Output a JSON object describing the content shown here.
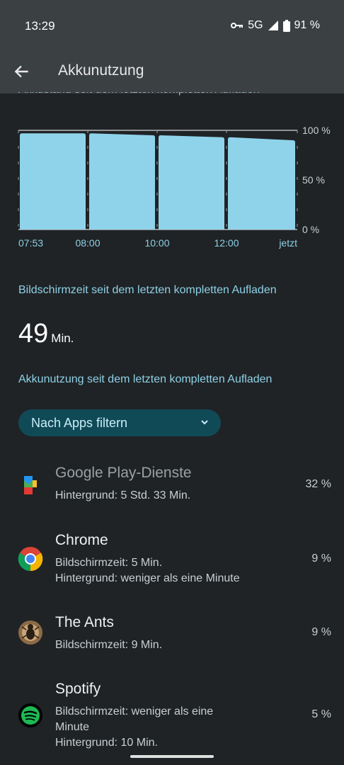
{
  "status": {
    "time": "13:29",
    "network": "5G",
    "battery": "91 %"
  },
  "appbar": {
    "title": "Akkunutzung"
  },
  "cut_text": "Akkustand seit dem letzten kompletten Aufladen",
  "chart_data": {
    "type": "bar",
    "categories": [
      "07:53–08:00",
      "08:00–10:00",
      "10:00–12:00",
      "12:00–jetzt"
    ],
    "values_start": [
      97,
      97,
      95,
      93
    ],
    "values_end": [
      97,
      95,
      93,
      90
    ],
    "ylim": [
      0,
      100
    ],
    "y_ticks": [
      "100 %",
      "50 %",
      "0 %"
    ],
    "x_ticks": [
      "07:53",
      "08:00",
      "10:00",
      "12:00",
      "jetzt"
    ],
    "bar_color": "#8fd3ea"
  },
  "screen_time": {
    "heading": "Bildschirmzeit seit dem letzten kompletten Aufladen",
    "value": "49",
    "unit": "Min."
  },
  "usage": {
    "heading": "Akkunutzung seit dem letzten kompletten Aufladen",
    "filter_label": "Nach Apps filtern"
  },
  "apps": [
    {
      "name": "Google Play-Dienste",
      "lines": [
        "Hintergrund: 5 Std. 33 Min."
      ],
      "percent": "32 %",
      "icon": "google-play-services-icon"
    },
    {
      "name": "Chrome",
      "lines": [
        "Bildschirmzeit: 5 Min.",
        "Hintergrund: weniger als eine Minute"
      ],
      "percent": "9 %",
      "icon": "chrome-icon"
    },
    {
      "name": "The Ants",
      "lines": [
        "Bildschirmzeit: 9 Min."
      ],
      "percent": "9 %",
      "icon": "the-ants-icon"
    },
    {
      "name": "Spotify",
      "lines": [
        "Bildschirmzeit: weniger als eine",
        "Minute",
        "Hintergrund: 10 Min."
      ],
      "percent": "5 %",
      "icon": "spotify-icon"
    }
  ]
}
